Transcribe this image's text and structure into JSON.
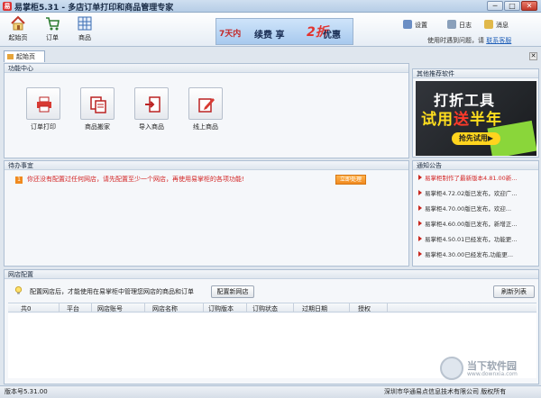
{
  "window": {
    "title": "易掌柜5.31 - 多店订单打印和商品管理专家",
    "minimize": "─",
    "maximize": "□",
    "close": "✕"
  },
  "toolbar": {
    "items": [
      {
        "label": "起始页",
        "icon": "home-icon"
      },
      {
        "label": "订单",
        "icon": "cart-icon"
      },
      {
        "label": "商品",
        "icon": "grid-icon"
      }
    ],
    "banner": {
      "part1": "7天内",
      "part2": "续费 享",
      "part3": "2折",
      "part4": "优惠"
    },
    "settings": "设置",
    "log": "日志",
    "messages": "消息",
    "time_prefix": "使用时遇到问题，请",
    "contact": "联系客服"
  },
  "tabs": [
    {
      "label": "起始页"
    }
  ],
  "tab_close": "✕",
  "func_center": {
    "title": "功能中心",
    "buttons": [
      {
        "label": "订单打印",
        "icon": "printer-icon"
      },
      {
        "label": "商品搬家",
        "icon": "copy-icon"
      },
      {
        "label": "导入商品",
        "icon": "import-icon"
      },
      {
        "label": "线上商品",
        "icon": "edit-icon"
      }
    ]
  },
  "recommend": {
    "title": "其他推荐软件",
    "line1": "打折工具",
    "line2a": "试用",
    "line2b": "送",
    "line2c": "半年",
    "button": "抢先试用▶"
  },
  "todo": {
    "title": "待办事宜",
    "items": [
      {
        "num": "1",
        "text": "你还没有配置过任何网店，请先配置至少一个网店，再使用易掌柜的各项功能!",
        "action": "立即处理"
      }
    ]
  },
  "notices": {
    "title": "通知公告",
    "items": [
      {
        "text": "易掌柜制作了最新版本4.81.00新..."
      },
      {
        "text": "易掌柜4.72.02版已发布，欢迎广..."
      },
      {
        "text": "易掌柜4.70.00版已发布，欢迎..."
      },
      {
        "text": "易掌柜4.60.00版已发布，新增正..."
      },
      {
        "text": "易掌柜4.50.01已经发布，功能更..."
      },
      {
        "text": "易掌柜4.30.00已经发布,功能更..."
      }
    ]
  },
  "store_config": {
    "title": "网店配置",
    "tip": "配置网店后，才能使用在易掌柜中管理您网店的商品和订单",
    "config_button": "配置新网店",
    "refresh_button": "刷新列表",
    "columns": [
      "共0",
      "平台",
      "网店账号",
      "网店名称",
      "订购版本",
      "订购状态",
      "过期日期",
      "授权"
    ]
  },
  "status": {
    "version": "版本号5.31.00",
    "company": "深圳市华通易点信息技术有限公司 版权所有"
  },
  "watermark": {
    "name": "当下软件园",
    "url": "www.downxia.com"
  },
  "colors": {
    "accent_red": "#d32424",
    "orange": "#f08a1f",
    "link_blue": "#1f5fb8"
  }
}
